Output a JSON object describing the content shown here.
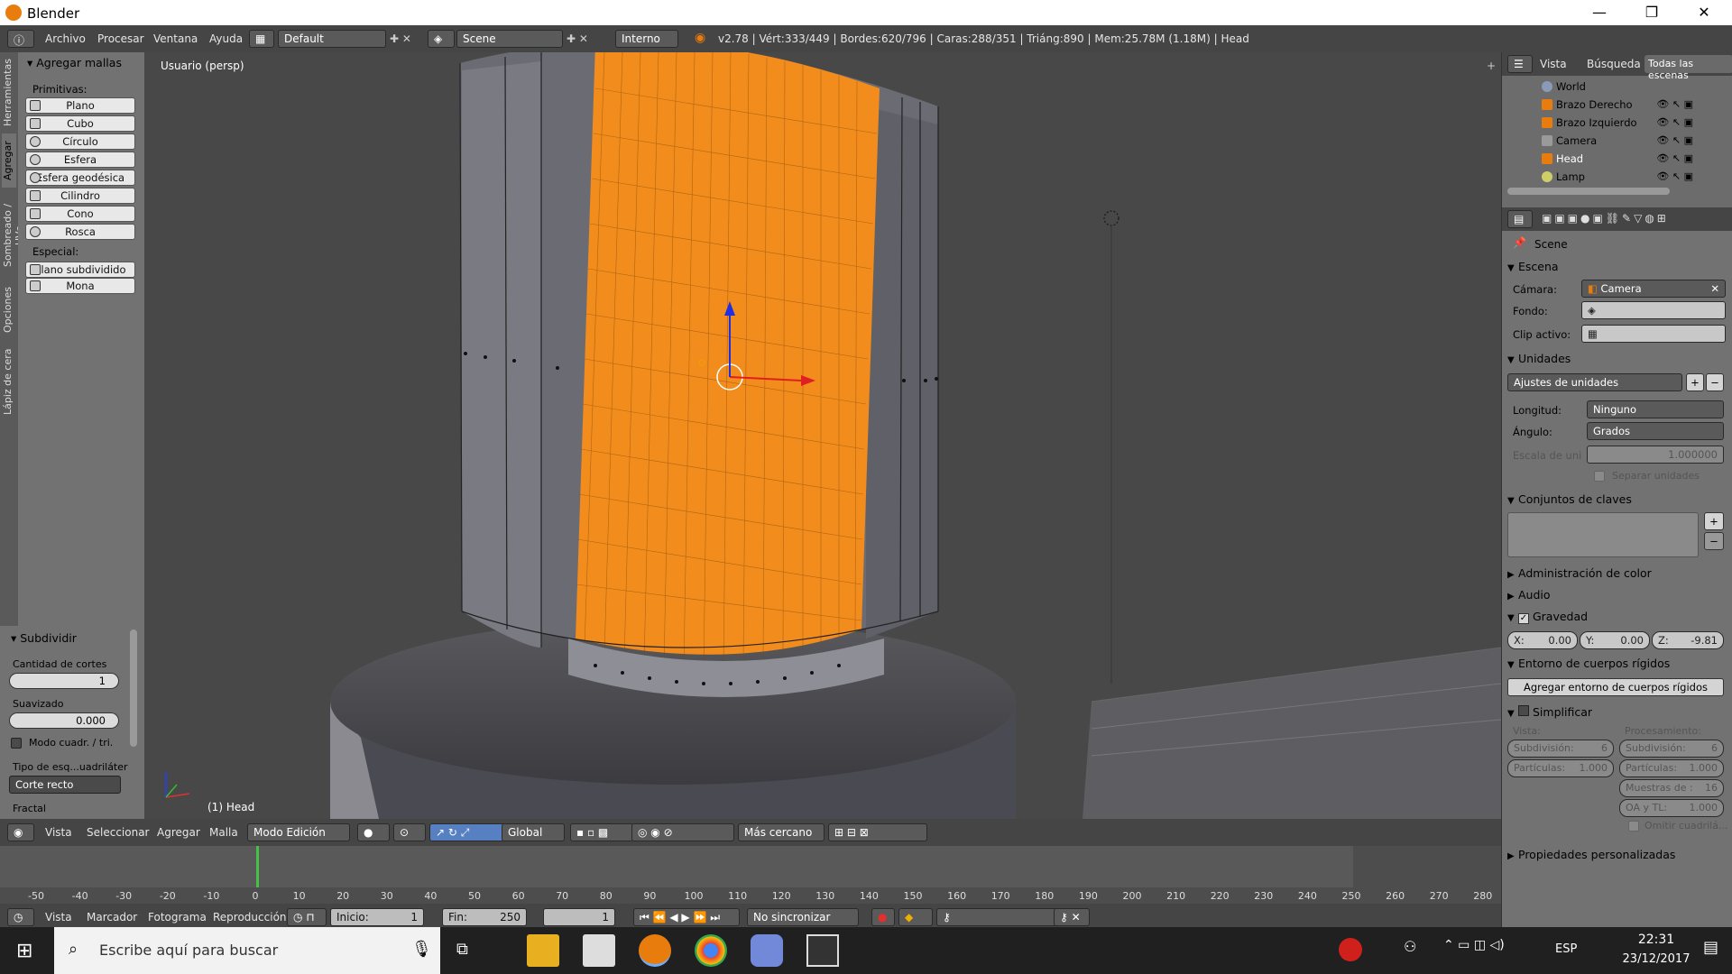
{
  "window": {
    "title": "Blender",
    "minimize": "—",
    "maximize": "❐",
    "close": "✕"
  },
  "infobar": {
    "menus": [
      "Archivo",
      "Procesar",
      "Ventana",
      "Ayuda"
    ],
    "layout": "Default",
    "scene": "Scene",
    "engine": "Interno",
    "stats": "v2.78 | Vért:333/449 | Bordes:620/796 | Caras:288/351 | Triáng:890 | Mem:25.78M (1.18M) | Head"
  },
  "left_tabs": [
    "Herramientas",
    "Agregar",
    "Sombreado / UVs",
    "Opciones",
    "Lápiz de cera"
  ],
  "toolshelf": {
    "title": "Agregar mallas",
    "primitives_label": "Primitivas:",
    "primitives": [
      "Plano",
      "Cubo",
      "Círculo",
      "Esfera",
      "Esfera geodésica",
      "Cilindro",
      "Cono",
      "Rosca"
    ],
    "special_label": "Especial:",
    "special": [
      "Plano subdividido",
      "Mona"
    ]
  },
  "operator": {
    "title": "Subdividir",
    "cuts_label": "Cantidad de cortes",
    "cuts_value": "1",
    "smooth_label": "Suavizado",
    "smooth_value": "0.000",
    "quad_tri_label": "Modo cuadr. / tri.",
    "corner_label": "Tipo de esq...uadriláter",
    "corner_value": "Corte recto",
    "fractal_label": "Fractal"
  },
  "viewport": {
    "view_label": "Usuario (persp)",
    "object_label": "(1) Head"
  },
  "view3d_header": {
    "menus": [
      "Vista",
      "Seleccionar",
      "Agregar",
      "Malla"
    ],
    "mode": "Modo Edición",
    "orientation": "Global",
    "snap": "Más cercano"
  },
  "timeline": {
    "ruler": [
      "-50",
      "-40",
      "-30",
      "-20",
      "-10",
      "0",
      "10",
      "20",
      "30",
      "40",
      "50",
      "60",
      "70",
      "80",
      "90",
      "100",
      "110",
      "120",
      "130",
      "140",
      "150",
      "160",
      "170",
      "180",
      "190",
      "200",
      "210",
      "220",
      "230",
      "240",
      "250",
      "260",
      "270",
      "280"
    ],
    "current_frame": 1,
    "menus": [
      "Vista",
      "Marcador",
      "Fotograma",
      "Reproducción"
    ],
    "start_label": "Inicio:",
    "start_value": "1",
    "end_label": "Fin:",
    "end_value": "250",
    "frame_value": "1",
    "sync": "No sincronizar"
  },
  "outliner": {
    "tabs": [
      "Vista",
      "Búsqueda",
      "Todas las escenas"
    ],
    "items": [
      {
        "name": "World",
        "icon": "world-icon"
      },
      {
        "name": "Brazo Derecho",
        "icon": "mesh-icon"
      },
      {
        "name": "Brazo Izquierdo",
        "icon": "mesh-icon"
      },
      {
        "name": "Camera",
        "icon": "camera-icon"
      },
      {
        "name": "Head",
        "icon": "mesh-icon"
      },
      {
        "name": "Lamp",
        "icon": "lamp-icon"
      }
    ]
  },
  "properties": {
    "scene_name": "Scene",
    "escena": {
      "title": "Escena",
      "camera_label": "Cámara:",
      "camera_value": "Camera",
      "background_label": "Fondo:",
      "clip_label": "Clip activo:"
    },
    "unidades": {
      "title": "Unidades",
      "preset": "Ajustes de unidades",
      "length_label": "Longitud:",
      "length_value": "Ninguno",
      "angle_label": "Ángulo:",
      "angle_value": "Grados",
      "scale_label": "Escala de uni",
      "scale_value": "1.000000",
      "separate_label": "Separar unidades"
    },
    "keysets_title": "Conjuntos de claves",
    "color_title": "Administración de color",
    "audio_title": "Audio",
    "gravity": {
      "title": "Gravedad",
      "x_label": "X:",
      "x": "0.00",
      "y_label": "Y:",
      "y": "0.00",
      "z_label": "Z:",
      "z": "-9.81"
    },
    "rigid": {
      "title": "Entorno de cuerpos rígidos",
      "button": "Agregar entorno de cuerpos rígidos"
    },
    "simplify": {
      "title": "Simplificar",
      "view_label": "Vista:",
      "render_label": "Procesamiento:",
      "subdiv_label": "Subdivisión:",
      "subdiv_view": "6",
      "subdiv_render": "6",
      "particles_label": "Partículas:",
      "particles_view": "1.000",
      "particles_render": "1.000",
      "aa_samples_label": "Muestras de :",
      "aa_samples": "16",
      "ao_label": "OA y TL:",
      "ao_value": "1.000",
      "skip_label": "Omitir cuadrilá..."
    },
    "custom_title": "Propiedades personalizadas"
  },
  "taskbar": {
    "search_placeholder": "Escribe aquí para buscar",
    "lang": "ESP",
    "time": "22:31",
    "date": "23/12/2017"
  },
  "colors": {
    "selection": "#f28c1d",
    "viewport_bg": "#4a4a4a",
    "panel_bg": "#727272",
    "header_bg": "#454545"
  }
}
